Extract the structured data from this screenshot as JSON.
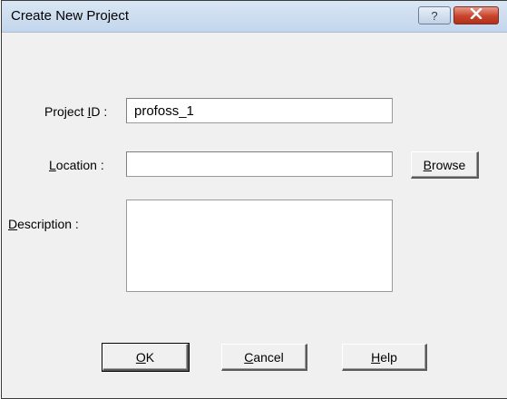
{
  "window": {
    "title": "Create New Project",
    "help_glyph": "?",
    "close_icon": "close-icon"
  },
  "form": {
    "project_id": {
      "label_pre": "Project ",
      "label_mnemonic": "I",
      "label_post": "D :",
      "value": "profoss_1"
    },
    "location": {
      "label_mnemonic": "L",
      "label_post": "ocation :",
      "value": ""
    },
    "description": {
      "label_mnemonic": "D",
      "label_post": "escription :",
      "value": ""
    }
  },
  "buttons": {
    "browse": {
      "mnemonic": "B",
      "rest": "rowse"
    },
    "ok": {
      "mnemonic": "O",
      "rest": "K"
    },
    "cancel": {
      "mnemonic": "C",
      "rest": "ancel"
    },
    "help": {
      "mnemonic": "H",
      "rest": "elp"
    }
  },
  "colors": {
    "dialog_bg": "#f0f0f0",
    "titlebar": "#c3d6ec",
    "close_button": "#c8432b"
  }
}
